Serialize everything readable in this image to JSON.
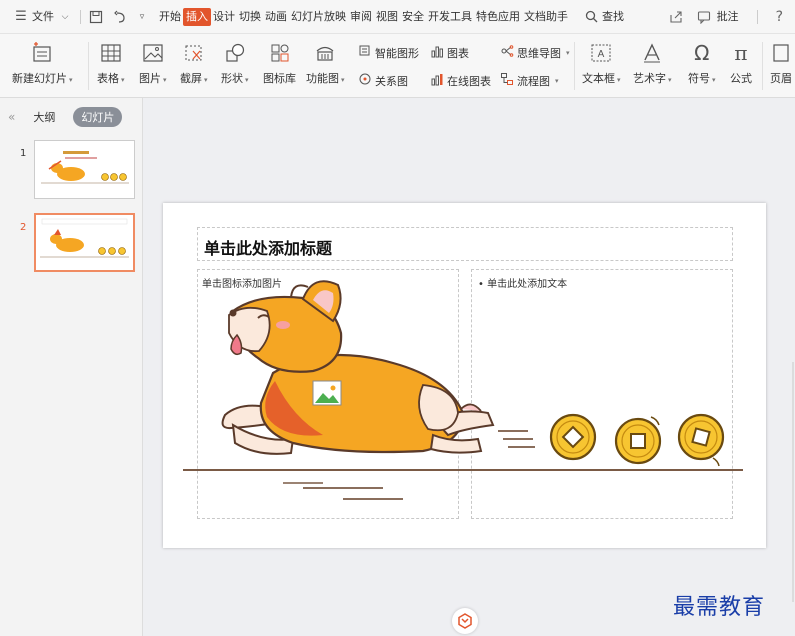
{
  "menubar": {
    "file_menu": "文件",
    "tabs": [
      {
        "label": "开始",
        "active": false
      },
      {
        "label": "插入",
        "active": true
      },
      {
        "label": "设计",
        "active": false
      },
      {
        "label": "切换",
        "active": false
      },
      {
        "label": "动画",
        "active": false
      },
      {
        "label": "幻灯片放映",
        "active": false
      },
      {
        "label": "审阅",
        "active": false
      },
      {
        "label": "视图",
        "active": false
      },
      {
        "label": "安全",
        "active": false
      },
      {
        "label": "开发工具",
        "active": false
      },
      {
        "label": "特色应用",
        "active": false
      },
      {
        "label": "文档助手",
        "active": false
      }
    ],
    "search_label": "查找",
    "comment_label": "批注",
    "help_label": "?"
  },
  "ribbon": {
    "new_slide": "新建幻灯片",
    "table": "表格",
    "picture": "图片",
    "screenshot": "截屏",
    "shape": "形状",
    "icon_library": "图标库",
    "function_chart": "功能图",
    "smart_art": "智能图形",
    "chart": "图表",
    "mind_map": "思维导图",
    "relation": "关系图",
    "online_chart": "在线图表",
    "flowchart": "流程图",
    "textbox": "文本框",
    "word_art": "艺术字",
    "symbol": "符号",
    "formula": "公式",
    "header_footer": "页眉"
  },
  "left_panel": {
    "tab_outline": "大纲",
    "tab_slides": "幻灯片",
    "slides": [
      {
        "number": "1",
        "selected": false
      },
      {
        "number": "2",
        "selected": true
      }
    ]
  },
  "slide": {
    "title_placeholder": "单击此处添加标题",
    "left_placeholder": "单击图标添加图片",
    "right_placeholder": "• 单击此处添加文本"
  },
  "watermark": "最需教育",
  "colors": {
    "accent": "#e2552c",
    "corgi_orange": "#f5a623",
    "coin_gold": "#f7c531"
  }
}
